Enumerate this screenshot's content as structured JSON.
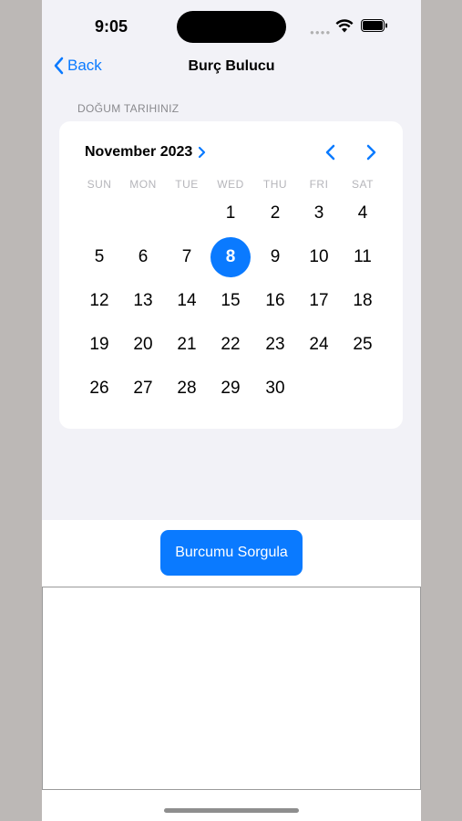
{
  "status_bar": {
    "time": "9:05"
  },
  "nav": {
    "back_label": "Back",
    "title": "Burç Bulucu"
  },
  "section_label": "DOĞUM TARIHINIZ",
  "calendar": {
    "month_label": "November 2023",
    "weekdays": [
      "SUN",
      "MON",
      "TUE",
      "WED",
      "THU",
      "FRI",
      "SAT"
    ],
    "selected_day": "8",
    "weeks": [
      [
        "",
        "",
        "",
        "1",
        "2",
        "3",
        "4"
      ],
      [
        "5",
        "6",
        "7",
        "8",
        "9",
        "10",
        "11"
      ],
      [
        "12",
        "13",
        "14",
        "15",
        "16",
        "17",
        "18"
      ],
      [
        "19",
        "20",
        "21",
        "22",
        "23",
        "24",
        "25"
      ],
      [
        "26",
        "27",
        "28",
        "29",
        "30",
        "",
        ""
      ]
    ]
  },
  "query_button_label": "Burcumu Sorgula",
  "result_text": "",
  "colors": {
    "accent": "#0a7aff",
    "background": "#f2f2f7",
    "card": "#ffffff"
  },
  "icons": [
    "wifi-icon",
    "battery-icon",
    "chevron-left-icon",
    "chevron-right-icon"
  ]
}
